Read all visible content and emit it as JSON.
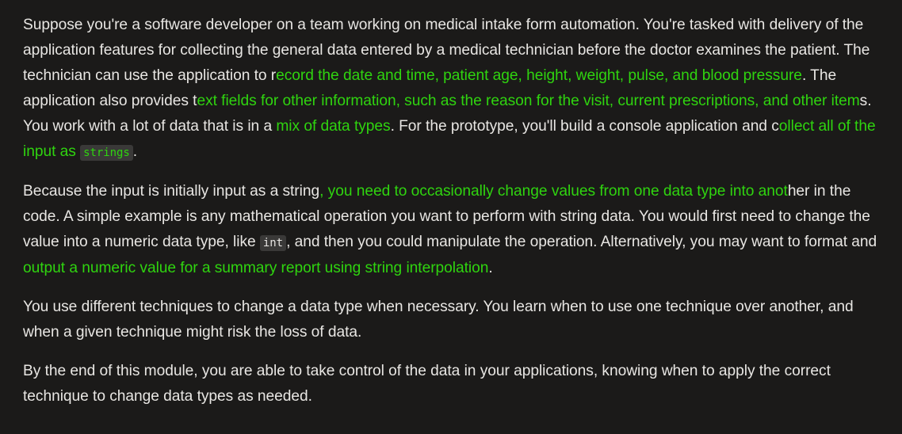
{
  "colors": {
    "background": "#1b1a19",
    "text": "#e8e6e3",
    "highlight": "#2fd40f",
    "code_background": "#3a3938"
  },
  "paragraphs": [
    {
      "segments": [
        {
          "text": "Suppose you're a software developer on a team working on medical intake form automation. You're tasked with delivery of the application features for collecting the general data entered by a medical technician before the doctor examines the patient. The technician can use the application to r",
          "style": "normal"
        },
        {
          "text": "ecord the date and time, patient age, height, weight, pulse, and blood pressure",
          "style": "highlight"
        },
        {
          "text": ". The application also provides t",
          "style": "normal"
        },
        {
          "text": "ext fields for other information, such as the reason for the visit, current prescriptions, and other item",
          "style": "highlight"
        },
        {
          "text": "s. You work with a lot of data that is in a ",
          "style": "normal"
        },
        {
          "text": "mix of data types",
          "style": "highlight"
        },
        {
          "text": ". For the prototype, you'll build a console application and c",
          "style": "normal"
        },
        {
          "text": "ollect all of the input as ",
          "style": "highlight"
        },
        {
          "text": "strings",
          "style": "code-highlight"
        },
        {
          "text": ".",
          "style": "normal"
        }
      ]
    },
    {
      "segments": [
        {
          "text": "Because the input is initially input as a string",
          "style": "normal"
        },
        {
          "text": ", you need to occasionally change values from one data type into anot",
          "style": "highlight"
        },
        {
          "text": "her in the code. A simple example is any mathematical operation you want to perform with string data. You would first need to change the value into a numeric data type, like ",
          "style": "normal"
        },
        {
          "text": "int",
          "style": "code"
        },
        {
          "text": ", and then you could manipulate the operation. Alternatively, you may want to format and ",
          "style": "normal"
        },
        {
          "text": "output a numeric value for a summary report using string interpolation",
          "style": "highlight"
        },
        {
          "text": ".",
          "style": "normal"
        }
      ]
    },
    {
      "segments": [
        {
          "text": "You use different techniques to change a data type when necessary. You learn when to use one technique over another, and when a given technique might risk the loss of data.",
          "style": "normal"
        }
      ]
    },
    {
      "segments": [
        {
          "text": "By the end of this module, you are able to take control of the data in your applications, knowing when to apply the correct technique to change data types as needed.",
          "style": "normal"
        }
      ]
    }
  ]
}
